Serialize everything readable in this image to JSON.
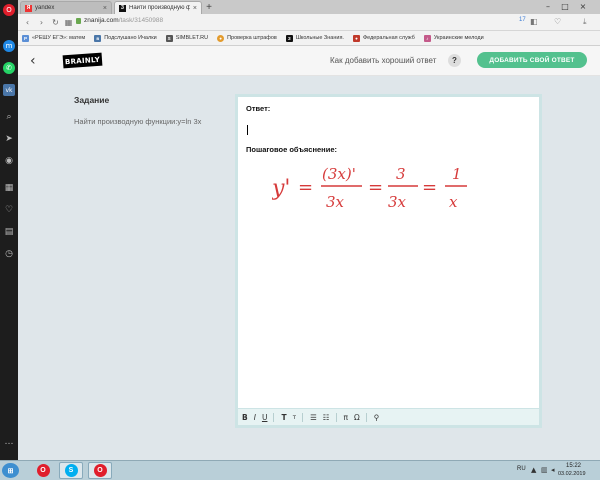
{
  "browser": {
    "tabs": [
      {
        "title": "yandex",
        "favicon": "yandex-icon",
        "active": false
      },
      {
        "title": "Найти производную функ",
        "favicon": "brainly-icon",
        "active": true
      }
    ],
    "new_tab_label": "+",
    "url": {
      "domain": "znanija.com",
      "path": "/task/31450988"
    },
    "counter": "17",
    "bookmarks": [
      {
        "label": "«РЕШУ ЕГЭ»: матем",
        "icon_color": "#5b8fd6"
      },
      {
        "label": "Подслушано Ичалки",
        "icon_color": "#4a76a8"
      },
      {
        "label": "SIMBLET.RU",
        "icon_color": "#555555"
      },
      {
        "label": "Проверка штрафов",
        "icon_color": "#e39b2d"
      },
      {
        "label": "Школьные Знания.",
        "icon_color": "#111111"
      },
      {
        "label": "Федеральная служб",
        "icon_color": "#c0392b"
      },
      {
        "label": "Украинские мелоди",
        "icon_color": "#c45a8a"
      }
    ]
  },
  "header": {
    "logo_text": "BRAINLY",
    "help_text": "Как добавить хороший ответ",
    "help_icon_glyph": "?",
    "add_answer_label": "ДОБАВИТЬ СВОЙ ОТВЕТ",
    "accent_color": "#53c18e"
  },
  "task": {
    "heading": "Задание",
    "text": "Найти производную функции:у=ln 3x"
  },
  "answer": {
    "answer_label": "Ответ:",
    "explanation_label": "Пошаговое объяснение:",
    "formula": {
      "lhs": "y'",
      "step1_num": "(3x)'",
      "step1_den": "3x",
      "step2_num": "3",
      "step2_den": "3x",
      "step3_num": "1",
      "step3_den": "x",
      "color": "#d63a3a"
    },
    "toolbar": [
      "B",
      "I",
      "U",
      "T",
      "т",
      "list-numbered",
      "list-bulleted",
      "π",
      "Ω",
      "link"
    ]
  },
  "taskbar": {
    "start_label": "⊞",
    "apps": [
      {
        "name": "opera-taskbar-icon",
        "glyph": "O",
        "color": "#e01e2c",
        "active": false
      },
      {
        "name": "skype-taskbar-icon",
        "glyph": "S",
        "color": "#00aff0",
        "active": true
      },
      {
        "name": "opera-taskbar-icon-2",
        "glyph": "O",
        "color": "#e01e2c",
        "active": true
      }
    ],
    "language": "RU",
    "time": "15:22",
    "date": "03.02.2019"
  }
}
